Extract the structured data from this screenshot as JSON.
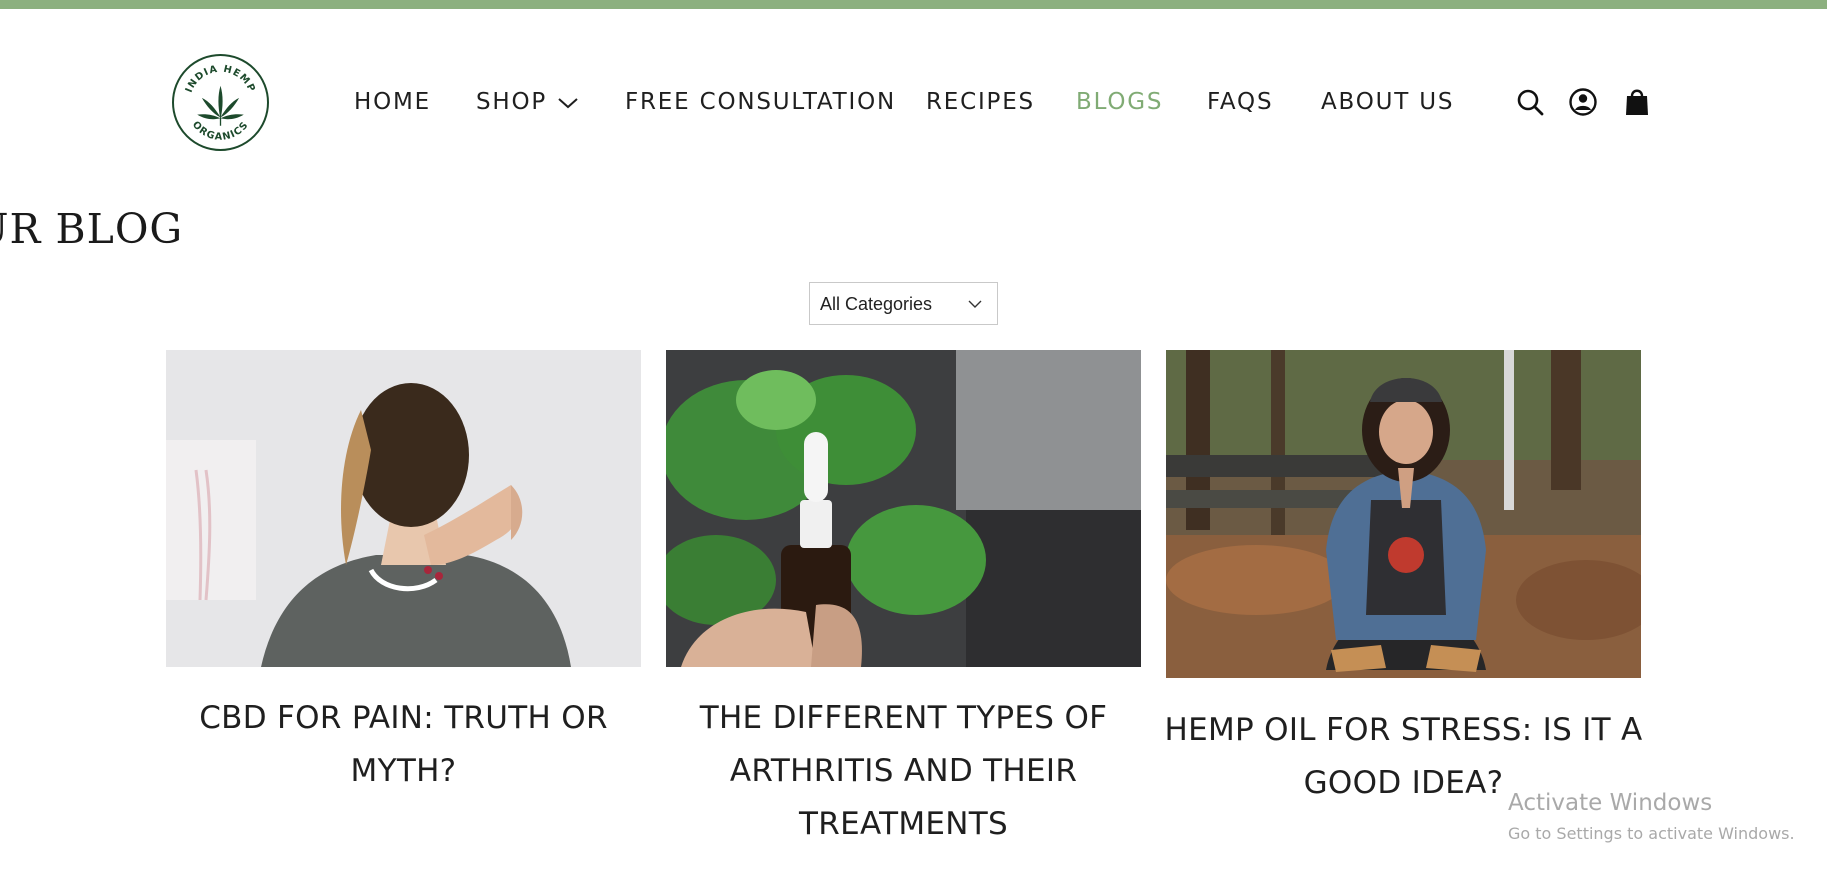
{
  "brand": {
    "logo_text_top": "INDIA HEMP",
    "logo_text_bottom": "ORGANICS",
    "accent_color": "#8cb07f",
    "logo_color": "#1d4a2c"
  },
  "nav": {
    "items": [
      {
        "label": "HOME"
      },
      {
        "label": "SHOP"
      },
      {
        "label": "FREE CONSULTATION"
      },
      {
        "label": "RECIPES"
      },
      {
        "label": "BLOGS",
        "active": true
      },
      {
        "label": "FAQS"
      },
      {
        "label": "ABOUT US"
      }
    ],
    "icons": [
      "search-icon",
      "account-icon",
      "cart-icon"
    ]
  },
  "page": {
    "title": "UR BLOG"
  },
  "filter": {
    "selected": "All Categories"
  },
  "posts": [
    {
      "title": "CBD FOR PAIN: TRUTH OR MYTH?"
    },
    {
      "title": "THE DIFFERENT TYPES OF ARTHRITIS AND THEIR TREATMENTS"
    },
    {
      "title": "HEMP OIL FOR STRESS: IS IT A GOOD IDEA?"
    }
  ],
  "watermark": {
    "title": "Activate Windows",
    "subtitle": "Go to Settings to activate Windows."
  }
}
